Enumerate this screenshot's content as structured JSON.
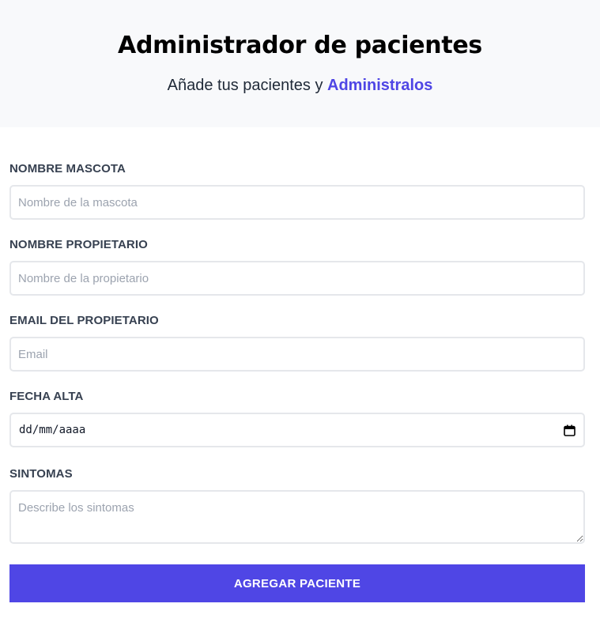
{
  "header": {
    "title": "Administrador de pacientes",
    "subtitle_prefix": "Añade tus pacientes y ",
    "subtitle_accent": "Administralos"
  },
  "form": {
    "pet_name": {
      "label": "NOMBRE MASCOTA",
      "placeholder": "Nombre de la mascota",
      "value": ""
    },
    "owner_name": {
      "label": "NOMBRE PROPIETARIO",
      "placeholder": "Nombre de la propietario",
      "value": ""
    },
    "owner_email": {
      "label": "EMAIL DEL PROPIETARIO",
      "placeholder": "Email",
      "value": ""
    },
    "date": {
      "label": "FECHA ALTA",
      "value": "dd/mm/aaaa",
      "icon": "calendar-icon"
    },
    "symptoms": {
      "label": "SINTOMAS",
      "placeholder": "Describe los sintomas",
      "value": ""
    },
    "submit_label": "AGREGAR PACIENTE"
  },
  "colors": {
    "accent": "#4f46e5",
    "header_bg": "#f8f9fb",
    "label": "#374151",
    "border": "#e5e7eb",
    "placeholder": "#9ca3af"
  }
}
